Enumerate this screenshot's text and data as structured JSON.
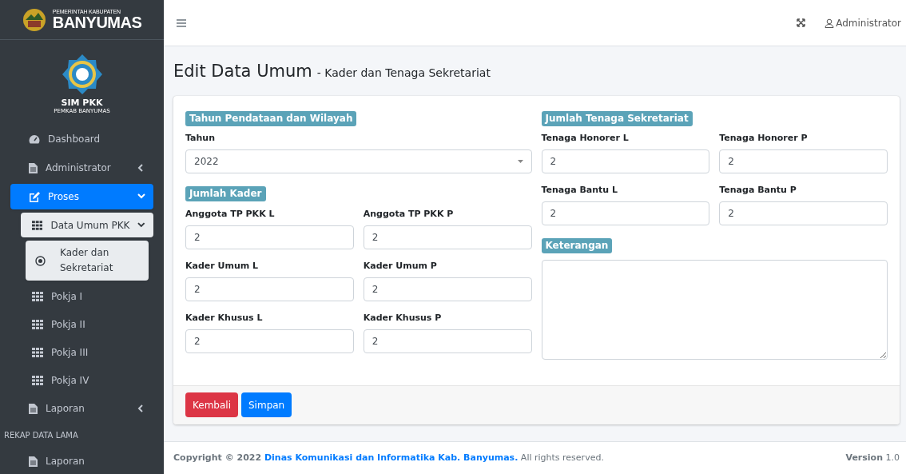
{
  "sidebar": {
    "brand": {
      "top": "PEMERINTAH KABUPATEN",
      "name": "BANYUMAS"
    },
    "app": {
      "name": "SIM PKK",
      "subtitle": "PEMKAB BANYUMAS"
    },
    "nav": [
      {
        "kind": "link",
        "label": "Dashboard",
        "selected": false
      },
      {
        "kind": "menu",
        "label": "Administrator",
        "selected": false,
        "expanded": false
      },
      {
        "kind": "menu",
        "label": "Proses",
        "selected": true,
        "expanded": true,
        "children": [
          {
            "kind": "menu",
            "label": "Data Umum PKK",
            "selected": true,
            "expanded": true,
            "children": [
              {
                "kind": "link",
                "label": "Kader dan Sekretariat",
                "selected": true
              }
            ]
          },
          {
            "kind": "link",
            "label": "Pokja I",
            "selected": false
          },
          {
            "kind": "link",
            "label": "Pokja II",
            "selected": false
          },
          {
            "kind": "link",
            "label": "Pokja III",
            "selected": false
          },
          {
            "kind": "link",
            "label": "Pokja IV",
            "selected": false
          }
        ]
      },
      {
        "kind": "menu",
        "label": "Laporan",
        "selected": false,
        "expanded": false
      },
      {
        "kind": "header",
        "label": "REKAP DATA LAMA"
      },
      {
        "kind": "link",
        "label": "Laporan",
        "selected": false
      }
    ]
  },
  "navbar": {
    "user": "Administrator"
  },
  "page": {
    "title": "Edit Data Umum",
    "subtitle": "- Kader dan Tenaga Sekretariat"
  },
  "form": {
    "columns": [
      [
        {
          "title": "Tahun Pendataan dan Wilayah",
          "fields": [
            {
              "kind": "select",
              "label": "Tahun",
              "value": "2022"
            }
          ]
        },
        {
          "title": "Jumlah Kader",
          "fields": [
            {
              "kind": "input",
              "label": "Anggota TP PKK L",
              "value": "2"
            },
            {
              "kind": "input",
              "label": "Anggota TP PKK P",
              "value": "2"
            },
            {
              "kind": "input",
              "label": "Kader Umum L",
              "value": "2"
            },
            {
              "kind": "input",
              "label": "Kader Umum P",
              "value": "2"
            },
            {
              "kind": "input",
              "label": "Kader Khusus L",
              "value": "2"
            },
            {
              "kind": "input",
              "label": "Kader Khusus P",
              "value": "2"
            }
          ]
        }
      ],
      [
        {
          "title": "Jumlah Tenaga Sekretariat",
          "fields": [
            {
              "kind": "input",
              "label": "Tenaga Honorer L",
              "value": "2"
            },
            {
              "kind": "input",
              "label": "Tenaga Honorer P",
              "value": "2"
            },
            {
              "kind": "input",
              "label": "Tenaga Bantu L",
              "value": "2"
            },
            {
              "kind": "input",
              "label": "Tenaga Bantu P",
              "value": "2"
            }
          ]
        },
        {
          "title": "Keterangan",
          "fields": [
            {
              "kind": "textarea"
            }
          ]
        }
      ]
    ],
    "buttons": [
      {
        "kind": "danger",
        "label": "Kembali"
      },
      {
        "kind": "primary",
        "label": "Simpan"
      }
    ]
  },
  "footer": {
    "copyright": "Copyright © 2022",
    "org": "Dinas Komunikasi dan Informatika Kab. Banyumas.",
    "rights": "All rights reserved.",
    "version_label": "Version",
    "version": "1.0"
  }
}
